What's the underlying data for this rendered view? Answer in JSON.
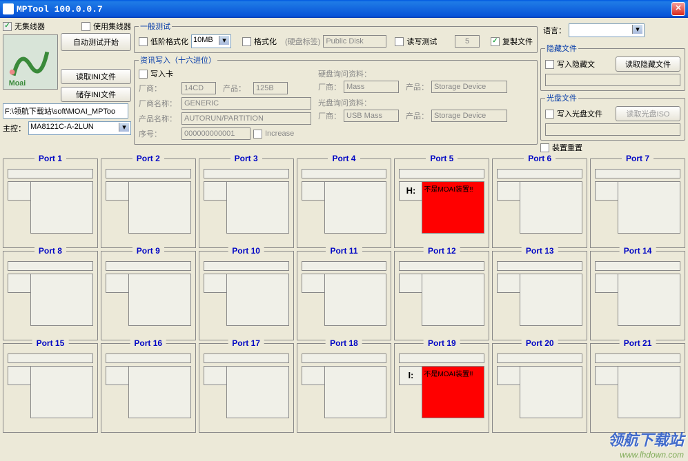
{
  "title": "MPTool 100.0.0.7",
  "leftPanel": {
    "noHub": "无集线器",
    "useHub": "使用集线器",
    "autoTest": "自动测试开始",
    "readIni": "读取INI文件",
    "saveIni": "储存INI文件",
    "path": "F:\\领航下载站\\soft\\MOAI_MPToo",
    "master": "主控：",
    "masterValue": "MA8121C-A-2LUN"
  },
  "generalTest": {
    "legend": "一般测试",
    "lowFormat": "低阶格式化",
    "sizeValue": "10MB",
    "format": "格式化",
    "diskLabel": "(硬盘标签)",
    "diskLabelValue": "Public Disk",
    "rwTest": "读写测试",
    "countValue": "5",
    "copyFiles": "复製文件"
  },
  "hexInfo": {
    "legend": "资讯写入（十六进位）",
    "writeCard": "写入卡",
    "vendor": "厂商：",
    "vendorVal": "14CD",
    "product": "产品：",
    "productVal": "125B",
    "vendorName": "厂商名称：",
    "vendorNameVal": "GENERIC",
    "productName": "产品名称：",
    "productNameVal": "AUTORUN/PARTITION",
    "serial": "序号：",
    "serialVal": "000000000001",
    "increase": "Increase",
    "hddInquiry": "硬盘询问资料：",
    "cdInquiry": "光盘询问资料：",
    "hddVendorVal": "Mass",
    "hddProductVal": "Storage Device",
    "cdVendorVal": "USB Mass",
    "cdProductVal": "Storage Device"
  },
  "language": {
    "label": "语言："
  },
  "hiddenFiles": {
    "legend": "隐藏文件",
    "writeHidden": "写入隐藏文",
    "readHidden": "读取隐藏文件"
  },
  "cdFiles": {
    "legend": "光盘文件",
    "writeCd": "写入光盘文件",
    "readIso": "读取光盘ISO"
  },
  "deviceReset": "装置重置",
  "ports": [
    {
      "n": 1
    },
    {
      "n": 2
    },
    {
      "n": 3
    },
    {
      "n": 4
    },
    {
      "n": 5,
      "drive": "H:",
      "err": "不是MOAI装置!!"
    },
    {
      "n": 6
    },
    {
      "n": 7
    },
    {
      "n": 8
    },
    {
      "n": 9
    },
    {
      "n": 10
    },
    {
      "n": 11
    },
    {
      "n": 12
    },
    {
      "n": 13
    },
    {
      "n": 14
    },
    {
      "n": 15
    },
    {
      "n": 16
    },
    {
      "n": 17
    },
    {
      "n": 18
    },
    {
      "n": 19,
      "drive": "I:",
      "err": "不是MOAI装置!!"
    },
    {
      "n": 20
    },
    {
      "n": 21
    }
  ],
  "watermark": {
    "cn": "领航下载站",
    "url": "www.lhdown.com"
  }
}
